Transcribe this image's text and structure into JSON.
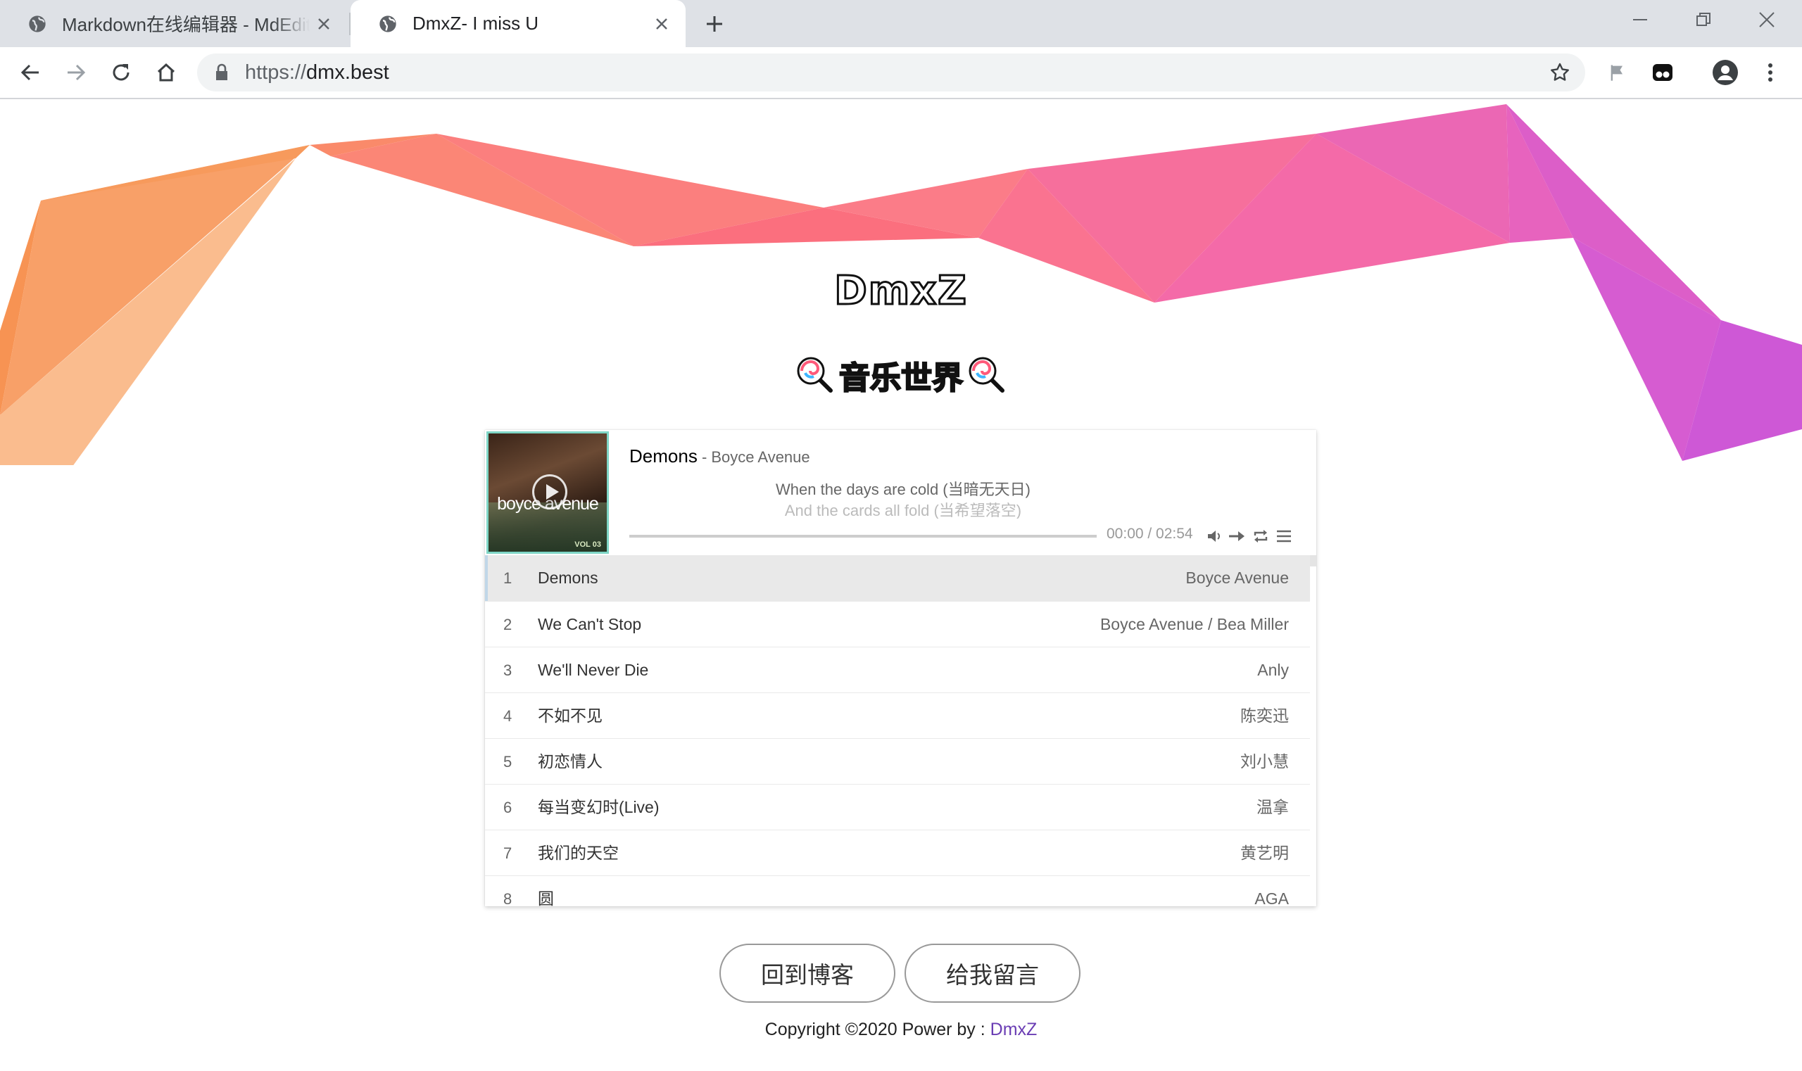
{
  "browser": {
    "tabs": [
      {
        "title": "Markdown在线编辑器 - MdEditor",
        "active": false
      },
      {
        "title": "DmxZ- I miss U",
        "active": true
      }
    ],
    "url_scheme": "https://",
    "url_host": "dmx.best"
  },
  "page": {
    "logo": "DmxZ",
    "subtitle": "音乐世界",
    "buttons": {
      "back_blog": "回到博客",
      "message": "给我留言"
    },
    "copyright_prefix": "Copyright ©2020 Power by : ",
    "copyright_link": "DmxZ"
  },
  "player": {
    "cover_brand": "boyce avenue",
    "cover_vol": "VOL 03",
    "now_playing": {
      "title": "Demons",
      "artist": " - Boyce Avenue"
    },
    "lyrics": [
      "When the days are cold (当暗无天日)",
      "And the cards all fold (当希望落空)"
    ],
    "time": "00:00 / 02:54",
    "progress": 0.0,
    "playlist": [
      {
        "index": "1",
        "name": "Demons",
        "author": "Boyce Avenue",
        "active": true
      },
      {
        "index": "2",
        "name": "We Can't Stop",
        "author": "Boyce Avenue / Bea Miller"
      },
      {
        "index": "3",
        "name": "We'll Never Die",
        "author": "Anly"
      },
      {
        "index": "4",
        "name": "不如不见",
        "author": "陈奕迅"
      },
      {
        "index": "5",
        "name": "初恋情人",
        "author": "刘小慧"
      },
      {
        "index": "6",
        "name": "每当变幻时(Live)",
        "author": "温拿"
      },
      {
        "index": "7",
        "name": "我们的天空",
        "author": "黄艺明"
      },
      {
        "index": "8",
        "name": "圆",
        "author": "AGA"
      }
    ]
  }
}
